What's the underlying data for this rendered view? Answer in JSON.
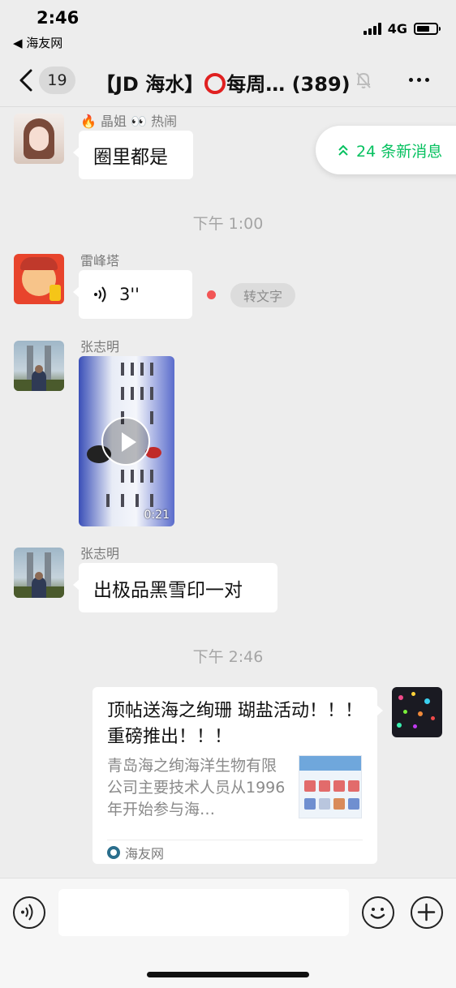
{
  "status_bar": {
    "time": "2:46",
    "back_app": "◀ 海友网",
    "network": "4G"
  },
  "nav": {
    "unread_count": "19",
    "title_part1": "【JD 海水】",
    "title_part2": "每周… (389)"
  },
  "new_messages": {
    "label": "24 条新消息"
  },
  "messages": {
    "m1": {
      "sender": "🔥 晶姐 👀 热闹",
      "text": "圈里都是"
    },
    "sep1": {
      "time": "下午 1:00"
    },
    "m2": {
      "sender": "雷峰塔",
      "duration": "3''",
      "convert_label": "转文字"
    },
    "m3": {
      "sender": "张志明",
      "video_duration": "0:21"
    },
    "m4": {
      "sender": "张志明",
      "text": "出极品黑雪印一对"
    },
    "sep2": {
      "time": "下午 2:46"
    },
    "m5": {
      "card_title": "顶帖送海之绚珊 瑚盐活动！！！ 重磅推出！！！",
      "card_desc": "青岛海之绚海洋生物有限公司主要技术人员从1996年开始参与海…",
      "card_source": "海友网"
    }
  },
  "input_bar": {
    "placeholder": ""
  },
  "colors": {
    "accent_green": "#07c160",
    "unread_red": "#f25555",
    "background": "#ededed"
  }
}
